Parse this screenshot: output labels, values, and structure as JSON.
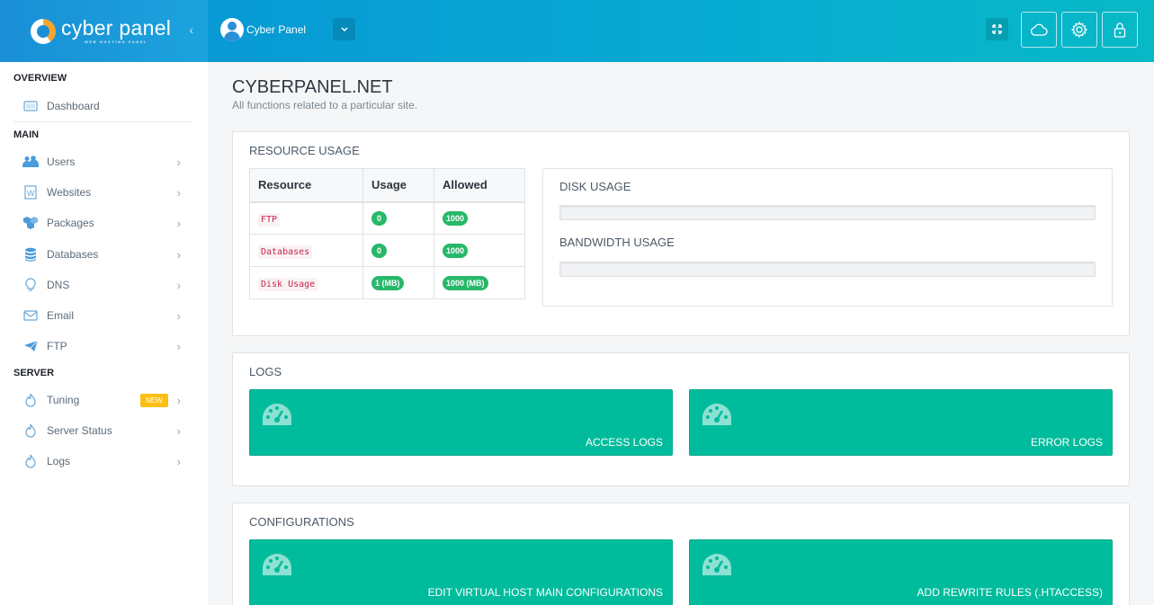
{
  "brand": {
    "name": "cyber panel",
    "tagline": "WEB HOSTING PANEL"
  },
  "header": {
    "user_name": "Cyber Panel",
    "icons": [
      "expand-icon",
      "cloud-icon",
      "gear-icon",
      "lock-icon"
    ]
  },
  "sidebar": {
    "sections": {
      "overview": "OVERVIEW",
      "main": "MAIN",
      "server": "SERVER"
    },
    "overview_items": [
      {
        "label": "Dashboard",
        "icon": "monitor-icon"
      }
    ],
    "main_items": [
      {
        "label": "Users",
        "icon": "users-icon"
      },
      {
        "label": "Websites",
        "icon": "wordpress-icon"
      },
      {
        "label": "Packages",
        "icon": "cubes-icon"
      },
      {
        "label": "Databases",
        "icon": "database-icon"
      },
      {
        "label": "DNS",
        "icon": "lightbulb-icon"
      },
      {
        "label": "Email",
        "icon": "envelope-icon"
      },
      {
        "label": "FTP",
        "icon": "paper-plane-icon"
      }
    ],
    "server_items": [
      {
        "label": "Tuning",
        "icon": "fire-icon",
        "badge": "NEW"
      },
      {
        "label": "Server Status",
        "icon": "fire-icon"
      },
      {
        "label": "Logs",
        "icon": "fire-icon"
      }
    ]
  },
  "page": {
    "title": "CYBERPANEL.NET",
    "subtitle": "All functions related to a particular site."
  },
  "resource_usage": {
    "title": "RESOURCE USAGE",
    "columns": [
      "Resource",
      "Usage",
      "Allowed"
    ],
    "rows": [
      {
        "resource": "FTP",
        "usage": "0",
        "allowed": "1000"
      },
      {
        "resource": "Databases",
        "usage": "0",
        "allowed": "1000"
      },
      {
        "resource": "Disk Usage",
        "usage": "1 (MB)",
        "allowed": "1000 (MB)"
      }
    ],
    "disk_usage_label": "DISK USAGE",
    "disk_usage_percent": 0,
    "bandwidth_usage_label": "BANDWIDTH USAGE",
    "bandwidth_usage_percent": 0
  },
  "logs": {
    "title": "LOGS",
    "tiles": [
      "ACCESS LOGS",
      "ERROR LOGS"
    ]
  },
  "configurations": {
    "title": "CONFIGURATIONS",
    "tiles": [
      "EDIT VIRTUAL HOST MAIN CONFIGURATIONS",
      "ADD REWRITE RULES (.HTACCESS)"
    ]
  },
  "colors": {
    "header_blue": "#0799d4",
    "tile_teal": "#00bc9c",
    "pill_green": "#27b86a",
    "badge_yellow": "#fbbf13"
  }
}
